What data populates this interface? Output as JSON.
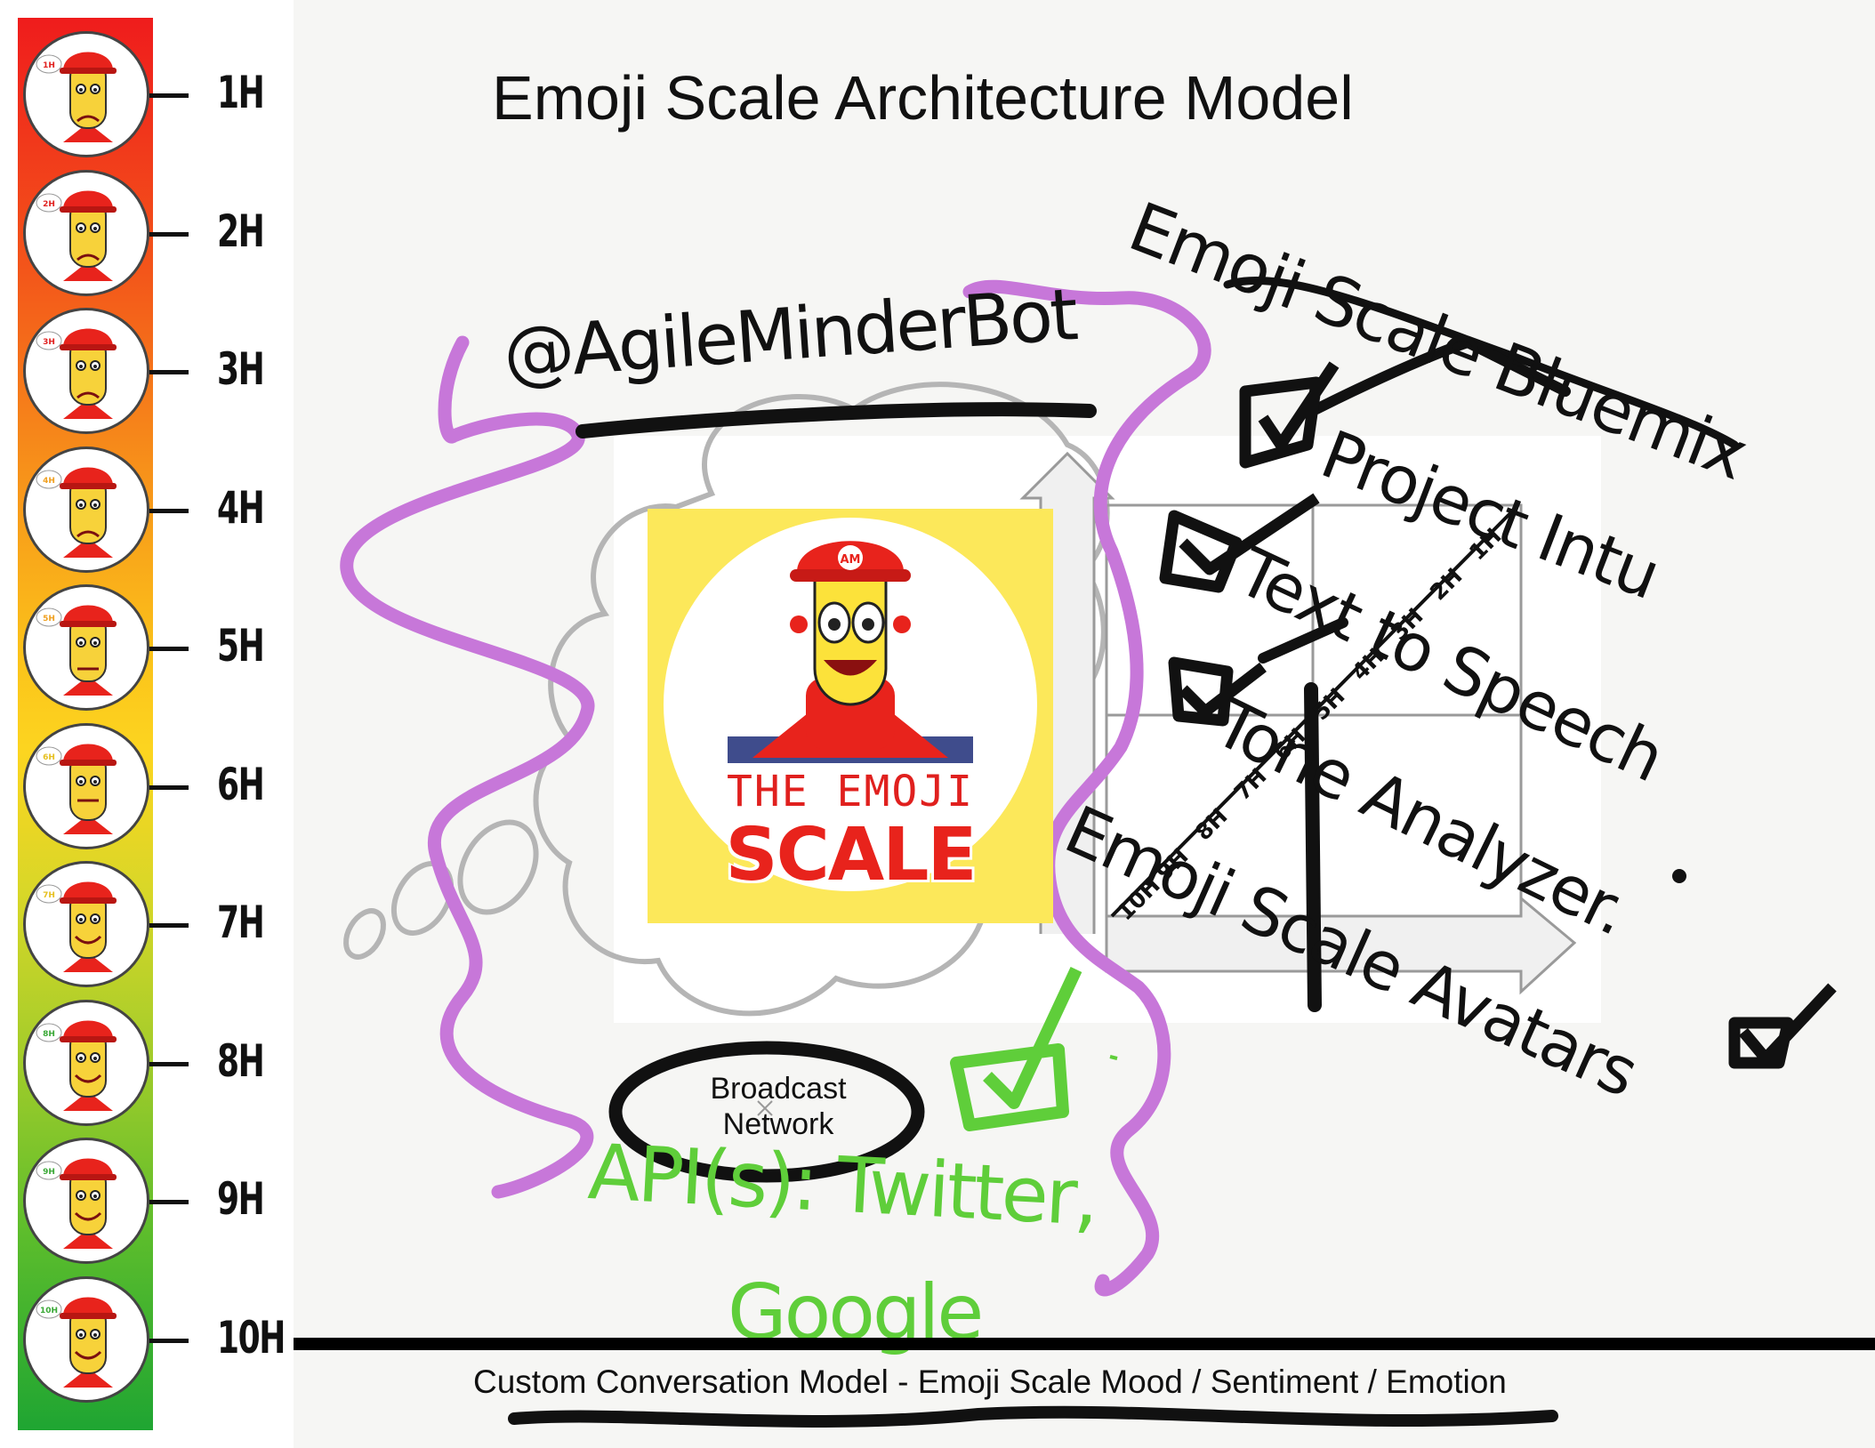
{
  "title": "Emoji Scale Architecture Model",
  "scale": {
    "levels": [
      {
        "label": "1H",
        "badge": "1H",
        "badge_color": "#e0201e"
      },
      {
        "label": "2H",
        "badge": "2H",
        "badge_color": "#e0201e"
      },
      {
        "label": "3H",
        "badge": "3H",
        "badge_color": "#e0201e"
      },
      {
        "label": "4H",
        "badge": "4H",
        "badge_color": "#f0a020"
      },
      {
        "label": "5H",
        "badge": "5H",
        "badge_color": "#f0a020"
      },
      {
        "label": "6H",
        "badge": "6H",
        "badge_color": "#e6c020"
      },
      {
        "label": "7H",
        "badge": "7H",
        "badge_color": "#e6c020"
      },
      {
        "label": "8H",
        "badge": "8H",
        "badge_color": "#3aa836"
      },
      {
        "label": "9H",
        "badge": "9H",
        "badge_color": "#3aa836"
      },
      {
        "label": "10H",
        "badge": "10H",
        "badge_color": "#3aa836"
      }
    ]
  },
  "bot_handle": "@AgileMinderBot",
  "logo": {
    "badge": "AM",
    "line1": "THE EMOJI",
    "line2": "SCALE"
  },
  "broadcast": {
    "line1": "Broadcast",
    "line2": "Network"
  },
  "api": {
    "line1": "API(s): Twitter,",
    "line2": "Google"
  },
  "bluemix": {
    "title": "Emoji Scale Bluemix",
    "items": [
      "Project Intu",
      "Text to Speech",
      "Tone Analyzer.",
      "Emoji Scale Avatars"
    ]
  },
  "grid_ticks": [
    "10H",
    "9H",
    "8H",
    "7H",
    "6H",
    "5H",
    "4H",
    "3H",
    "2H",
    "1H"
  ],
  "footer": "Custom Conversation Model - Emoji Scale Mood / Sentiment / Emotion",
  "colors": {
    "ink": "#111111",
    "purple": "#c777d9",
    "green": "#5fce3a",
    "logo_yellow": "#fce85a",
    "logo_red": "#e0201e"
  }
}
